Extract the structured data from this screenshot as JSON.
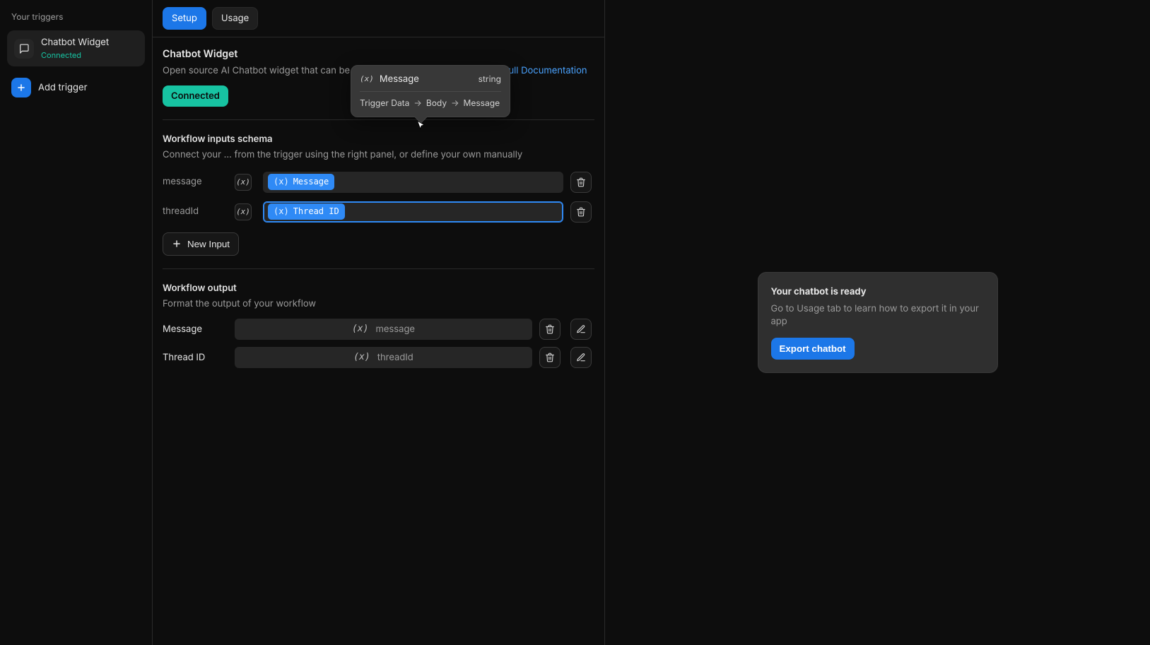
{
  "sidebar": {
    "title": "Your triggers",
    "active": {
      "name": "Chatbot Widget",
      "status": "Connected"
    },
    "add_label": "Add trigger"
  },
  "tabs": {
    "setup": "Setup",
    "usage": "Usage",
    "active": "setup"
  },
  "header": {
    "title": "Chatbot Widget",
    "subtitle": "Open source AI Chatbot widget that can be embedded in your app or website.",
    "doc_link": "Full Documentation",
    "connected": "Connected"
  },
  "inputs_section": {
    "title": "Workflow inputs schema",
    "subtitle": "Connect your … from the trigger using the right panel, or define your own manually",
    "new_input": "New Input",
    "rows": [
      {
        "name": "message",
        "value_label": "Message"
      },
      {
        "name": "threadId",
        "value_label": "Thread ID"
      }
    ]
  },
  "outputs_section": {
    "title": "Workflow output",
    "subtitle": "Format the output of your workflow",
    "rows": [
      {
        "name": "Message",
        "value": "message"
      },
      {
        "name": "Thread ID",
        "value": "threadId"
      }
    ]
  },
  "popover": {
    "title": "Message",
    "type": "string",
    "path": [
      "Trigger Data",
      "Body",
      "Message"
    ]
  },
  "right_card": {
    "title": "Your chatbot is ready",
    "desc": "Go to Usage tab to learn how to export it in your app",
    "cta": "Export chatbot"
  },
  "icons": {
    "var_prefix": "(x)",
    "plus": "+",
    "arrow": "→"
  }
}
